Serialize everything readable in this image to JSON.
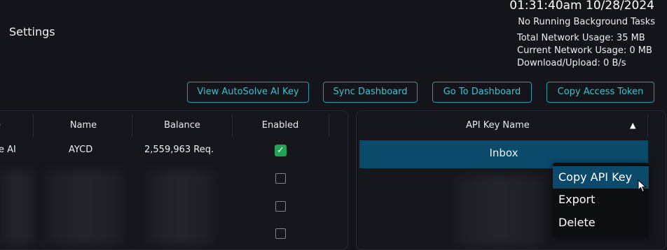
{
  "header": {
    "page_title": "Settings",
    "datetime": "01:31:40am 10/28/2024",
    "background_tasks": "No Running Background Tasks",
    "total_network_usage": "Total Network Usage:  35 MB",
    "current_network_usage": "Current Network Usage: 0 MB",
    "download_upload": "Download/Upload: 0 B/s"
  },
  "toolbar": {
    "view_autosolve_label": "View AutoSolve AI Key",
    "sync_dashboard_label": "Sync Dashboard",
    "go_dashboard_label": "Go To Dashboard",
    "copy_token_label": "Copy Access Token"
  },
  "left_table": {
    "columns": [
      "e",
      "Name",
      "Balance",
      "Enabled"
    ],
    "rows": [
      {
        "type": "e AI",
        "name": "AYCD",
        "balance": "2,559,963 Req.",
        "enabled": true
      },
      {
        "enabled": false
      },
      {
        "enabled": false
      },
      {
        "enabled": false
      }
    ]
  },
  "right_table": {
    "column": "API Key Name",
    "sort_icon": "sort-ascending-icon",
    "rows": [
      "Inbox"
    ]
  },
  "context_menu": {
    "items": [
      "Copy API Key",
      "Export",
      "Delete"
    ],
    "hovered": "Copy API Key"
  },
  "colors": {
    "background": "#14151b",
    "accent": "#2a9ba6",
    "selected_row": "#0b4a6a",
    "check_green": "#23a455"
  }
}
